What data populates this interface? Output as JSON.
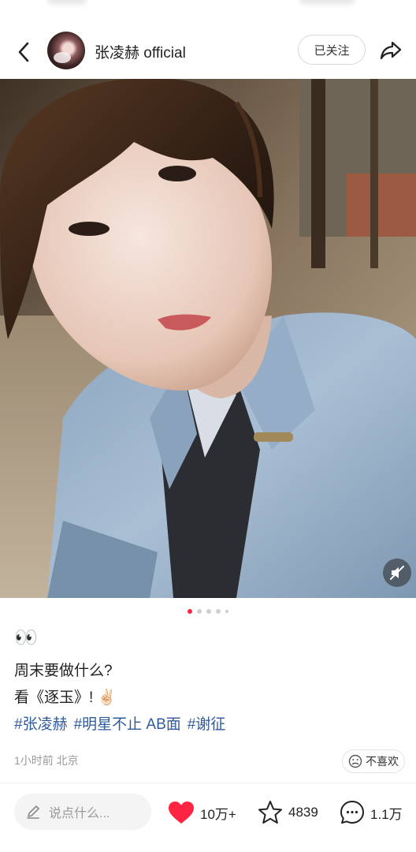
{
  "header": {
    "username": "张凌赫 official",
    "follow_label": "已关注"
  },
  "carousel": {
    "pages": 5,
    "active_index": 0
  },
  "post": {
    "emoji": "👀",
    "line1": "周末要做什么?",
    "line2": "看《逐玉》! ✌🏻",
    "tags": [
      "#张凌赫",
      "#明星不止 AB面",
      "#谢征"
    ],
    "time_location": "1小时前 北京",
    "dislike_label": "不喜欢"
  },
  "bottom": {
    "comment_placeholder": "说点什么...",
    "likes": "10万+",
    "favorites": "4839",
    "comments": "1.1万"
  },
  "colors": {
    "accent": "#ff2442",
    "tag": "#2f5b9c"
  },
  "icons": [
    "back-icon",
    "share-icon",
    "mute-icon",
    "pencil-icon",
    "heart-icon",
    "star-icon",
    "comment-icon",
    "dislike-face-icon"
  ]
}
